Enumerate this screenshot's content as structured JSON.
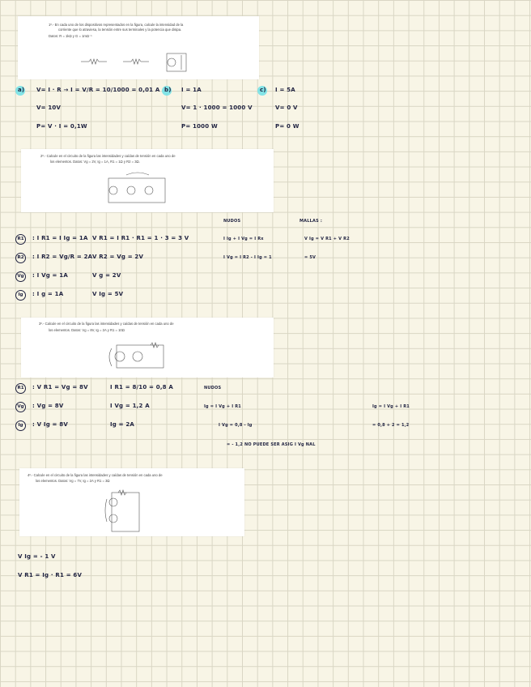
{
  "problem1": {
    "text_line1": "1º.- En cada uno de los dispositivos representados en la figura, calcule la intensidad de la",
    "text_line2": "corriente que lo atraviesa, la tensión entre sus terminales y la potencia que disipa.",
    "text_line3": "Datos: R = 1kΩ y G = 1mΩ⁻¹"
  },
  "part_a": {
    "label": "a)",
    "eq1": "V= I · R   →   I = V/R = 10/1000 = 0,01 A",
    "eq2": "V= 10V",
    "eq3": "P= V · I = 0,1W"
  },
  "part_b": {
    "label": "b)",
    "eq1": "I = 1A",
    "eq2": "V= 1 · 1000 = 1000 V",
    "eq3": "P= 1000 W"
  },
  "part_c": {
    "label": "c)",
    "eq1": "I = 5A",
    "eq2": "V= 0 V",
    "eq3": "P= 0 W"
  },
  "problem2": {
    "text_line1": "2º.- Calcule en el circuito de la figura las intensidades y caídas de tensión en cada uno de",
    "text_line2": "los elementos. Datos: Vg = 2V, Ig = 1A, R1 = 1Ω y R2 = 3Ω."
  },
  "p2_headers": {
    "left": "NUDOS",
    "right": "MALLAS :"
  },
  "p2_rows": [
    {
      "badge": "R1",
      "c1": ": I R1 = I Ig = 1A",
      "c2": "V R1 = I R1 · R1 = 1 · 3 = 3 V",
      "c3": "I Ig + I Vg = I Rx",
      "c4": "V Ig = V R1 + V R2"
    },
    {
      "badge": "R2",
      "c1": ": I R2 = Vg/R = 2A",
      "c2": "V R2 = Vg = 2V",
      "c3": "I Vg = I R2 - I Ig = 1",
      "c4": "= 5V"
    },
    {
      "badge": "Vg",
      "c1": ": I Vg = 1A",
      "c2": "V g = 2V",
      "c3": "",
      "c4": ""
    },
    {
      "badge": "Ig",
      "c1": ": I g = 1A",
      "c2": "V Ig = 5V",
      "c3": "",
      "c4": ""
    }
  ],
  "problem3": {
    "text_line1": "3º.- Calcule en el circuito de la figura las intensidades y caídas de tensión en cada uno de",
    "text_line2": "los elementos. Datos: Vg = 8V, Ig = 2A y R1 = 10Ω"
  },
  "p3_rows": [
    {
      "badge": "R1",
      "c1": ": V R1 = Vg = 8V",
      "c2": "I R1 = 8/10 = 0,8 A",
      "c3": "NUDOS",
      "c4": ""
    },
    {
      "badge": "Vg",
      "c1": ": Vg = 8V",
      "c2": "I Vg = 1,2 A",
      "c3": "Ig = I Vg + I R1",
      "c4": "Ig = I Vg + I R1"
    },
    {
      "badge": "Ig",
      "c1": ": V Ig = 8V",
      "c2": "Ig = 2A",
      "c3": "I Vg = 0,8 - Ig",
      "c4": "= 0,8 + 2 = 1,2"
    }
  ],
  "p3_note": "= - 1,2   NO PUEDE SER   ASIG I Vg NAL",
  "problem4": {
    "text_line1": "4º.- Calcule en el circuito de la figura las intensidades y caídas de tensión en cada uno de",
    "text_line2": "los elementos. Datos: Vg = 7V, Ig = 2A y R1 = 3Ω"
  },
  "p4_lines": {
    "l1": "V Ig = - 1 V",
    "l2": "V R1 = Ig · R1 = 6V"
  },
  "colors": {
    "highlight": "#6fe0e6",
    "ink": "#1f2240",
    "paper": "#f8f5e6",
    "grid": "#d9d6c4"
  }
}
